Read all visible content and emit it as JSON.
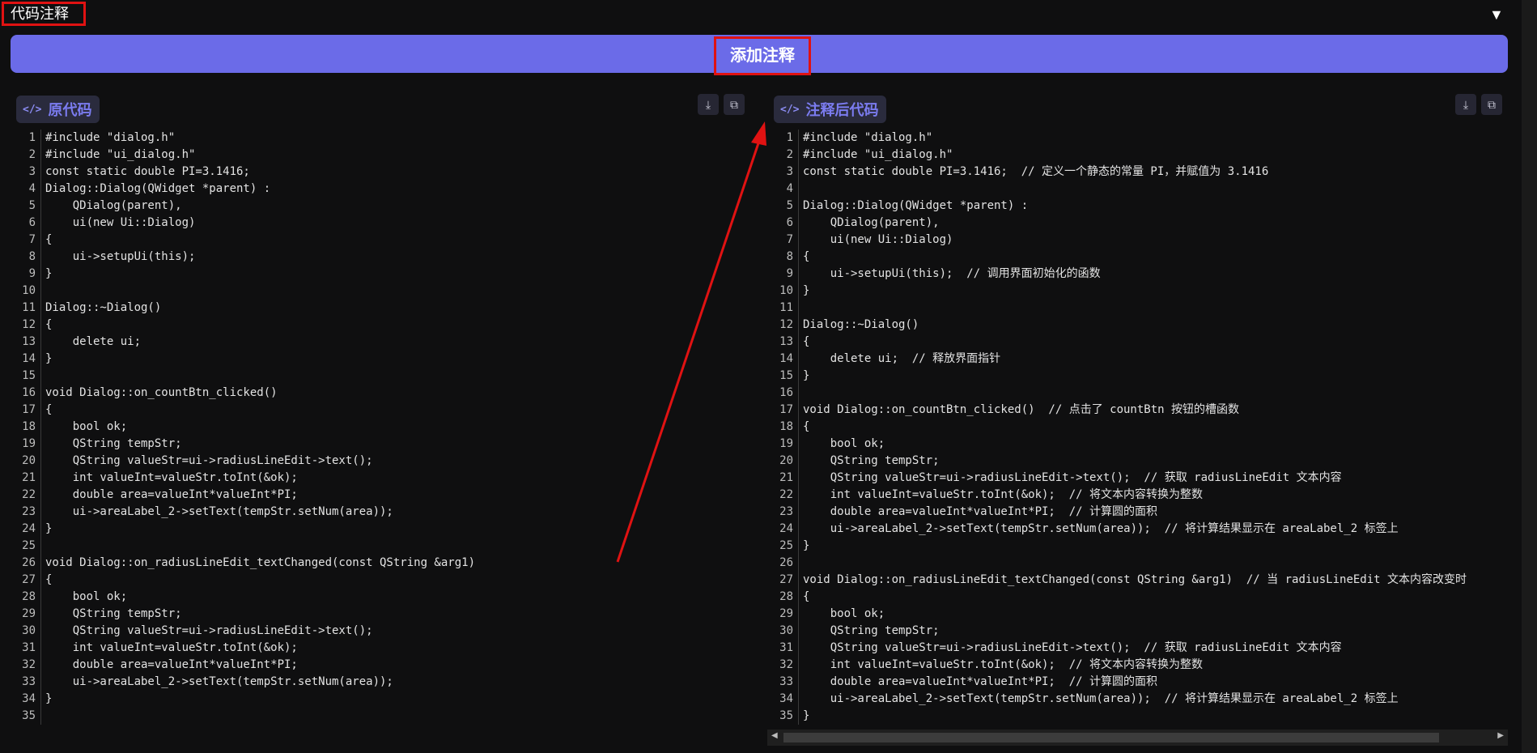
{
  "header": {
    "section_title": "代码注释",
    "collapse_icon": "▼"
  },
  "toolbar": {
    "add_comments_label": "添加注释"
  },
  "original": {
    "title": "原代码",
    "lines": [
      "#include \"dialog.h\"",
      "#include \"ui_dialog.h\"",
      "const static double PI=3.1416;",
      "Dialog::Dialog(QWidget *parent) :",
      "    QDialog(parent),",
      "    ui(new Ui::Dialog)",
      "{",
      "    ui->setupUi(this);",
      "}",
      "",
      "Dialog::~Dialog()",
      "{",
      "    delete ui;",
      "}",
      "",
      "void Dialog::on_countBtn_clicked()",
      "{",
      "    bool ok;",
      "    QString tempStr;",
      "    QString valueStr=ui->radiusLineEdit->text();",
      "    int valueInt=valueStr.toInt(&ok);",
      "    double area=valueInt*valueInt*PI;",
      "    ui->areaLabel_2->setText(tempStr.setNum(area));",
      "}",
      "",
      "void Dialog::on_radiusLineEdit_textChanged(const QString &arg1)",
      "{",
      "    bool ok;",
      "    QString tempStr;",
      "    QString valueStr=ui->radiusLineEdit->text();",
      "    int valueInt=valueStr.toInt(&ok);",
      "    double area=valueInt*valueInt*PI;",
      "    ui->areaLabel_2->setText(tempStr.setNum(area));",
      "}",
      ""
    ]
  },
  "commented": {
    "title": "注释后代码",
    "lines": [
      "#include \"dialog.h\"",
      "#include \"ui_dialog.h\"",
      "const static double PI=3.1416;  // 定义一个静态的常量 PI，并赋值为 3.1416",
      "",
      "Dialog::Dialog(QWidget *parent) :",
      "    QDialog(parent),",
      "    ui(new Ui::Dialog)",
      "{",
      "    ui->setupUi(this);  // 调用界面初始化的函数",
      "}",
      "",
      "Dialog::~Dialog()",
      "{",
      "    delete ui;  // 释放界面指针",
      "}",
      "",
      "void Dialog::on_countBtn_clicked()  // 点击了 countBtn 按钮的槽函数",
      "{",
      "    bool ok;",
      "    QString tempStr;",
      "    QString valueStr=ui->radiusLineEdit->text();  // 获取 radiusLineEdit 文本内容",
      "    int valueInt=valueStr.toInt(&ok);  // 将文本内容转换为整数",
      "    double area=valueInt*valueInt*PI;  // 计算圆的面积",
      "    ui->areaLabel_2->setText(tempStr.setNum(area));  // 将计算结果显示在 areaLabel_2 标签上",
      "}",
      "",
      "void Dialog::on_radiusLineEdit_textChanged(const QString &arg1)  // 当 radiusLineEdit 文本内容改变时",
      "{",
      "    bool ok;",
      "    QString tempStr;",
      "    QString valueStr=ui->radiusLineEdit->text();  // 获取 radiusLineEdit 文本内容",
      "    int valueInt=valueStr.toInt(&ok);  // 将文本内容转换为整数",
      "    double area=valueInt*valueInt*PI;  // 计算圆的面积",
      "    ui->areaLabel_2->setText(tempStr.setNum(area));  // 将计算结果显示在 areaLabel_2 标签上",
      "}"
    ]
  },
  "icons": {
    "code": "</>",
    "download": "⤓",
    "copy": "⧉"
  },
  "colors": {
    "accent": "#6b6be8",
    "highlight": "#e01212"
  }
}
